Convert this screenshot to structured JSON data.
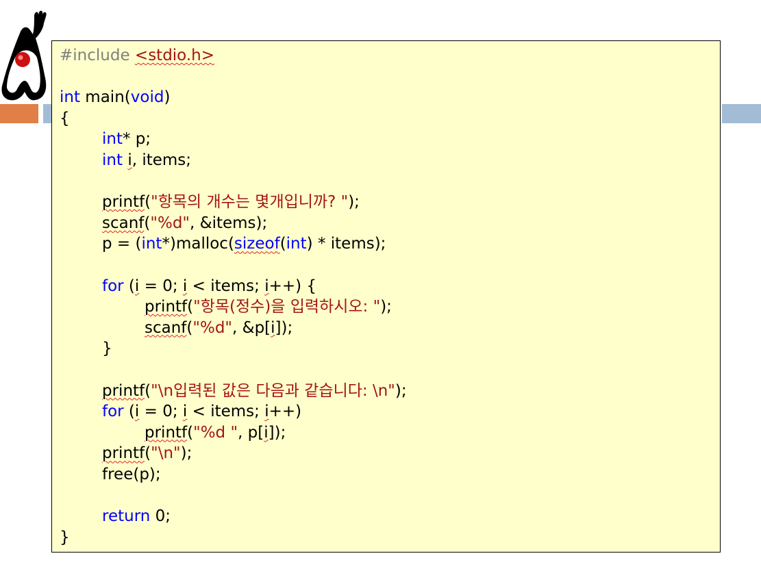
{
  "slide": {
    "accent_colors": {
      "orange": "#e07f46",
      "blue": "#a3bcd5"
    },
    "mascot_icon": "duke-waving-icon"
  },
  "code": {
    "background": "#ffffcc",
    "lines": {
      "l1_pp": "#include ",
      "l1_hdr": "<stdio.h>",
      "l3_kw1": "int",
      "l3_b": " main(",
      "l3_kw2": "void",
      "l3_c": ")",
      "l4": "{",
      "l5_kw": "int",
      "l5_b": "* p;",
      "l6_kw": "int",
      "l6_sp": " ",
      "l6_i": "i",
      "l6_b": ", items;",
      "l8_fn": "printf",
      "l8_p": "(",
      "l8_str": "\"항목의 개수는 몇개입니까? \"",
      "l8_e": ");",
      "l9_fn": "scanf",
      "l9_p": "(",
      "l9_str": "\"%d\"",
      "l9_e": ", &items);",
      "l10_a": "p = (",
      "l10_kw1": "int",
      "l10_b": "*)malloc(",
      "l10_kw2": "sizeof",
      "l10_c": "(",
      "l10_kw3": "int",
      "l10_d": ") * items);",
      "l12_kw": "for",
      "l12_a": " (",
      "l12_i1": "i",
      "l12_b": " = 0; ",
      "l12_i2": "i",
      "l12_c": " < items; ",
      "l12_i3": "i",
      "l12_d": "++) {",
      "l13_fn": "printf",
      "l13_p": "(",
      "l13_str": "\"항목(정수)을 입력하시오: \"",
      "l13_e": ");",
      "l14_fn": "scanf",
      "l14_p": "(",
      "l14_str": "\"%d\"",
      "l14_a": ", &p[",
      "l14_i": "i",
      "l14_e": "]);",
      "l15": "}",
      "l17_fn": "printf",
      "l17_p": "(",
      "l17_str": "\"\\n입력된 값은 다음과 같습니다: \\n\"",
      "l17_e": ");",
      "l18_kw": "for",
      "l18_a": " (",
      "l18_i1": "i",
      "l18_b": " = 0; ",
      "l18_i2": "i",
      "l18_c": " < items; ",
      "l18_i3": "i",
      "l18_d": "++)",
      "l19_fn": "printf",
      "l19_p": "(",
      "l19_str": "\"%d \"",
      "l19_a": ", p[",
      "l19_i": "i",
      "l19_e": "]);",
      "l20_fn": "printf",
      "l20_p": "(",
      "l20_str": "\"\\n\"",
      "l20_e": ");",
      "l21": "free(p);",
      "l23_kw": "return",
      "l23_b": " 0;",
      "l24": "}"
    }
  }
}
